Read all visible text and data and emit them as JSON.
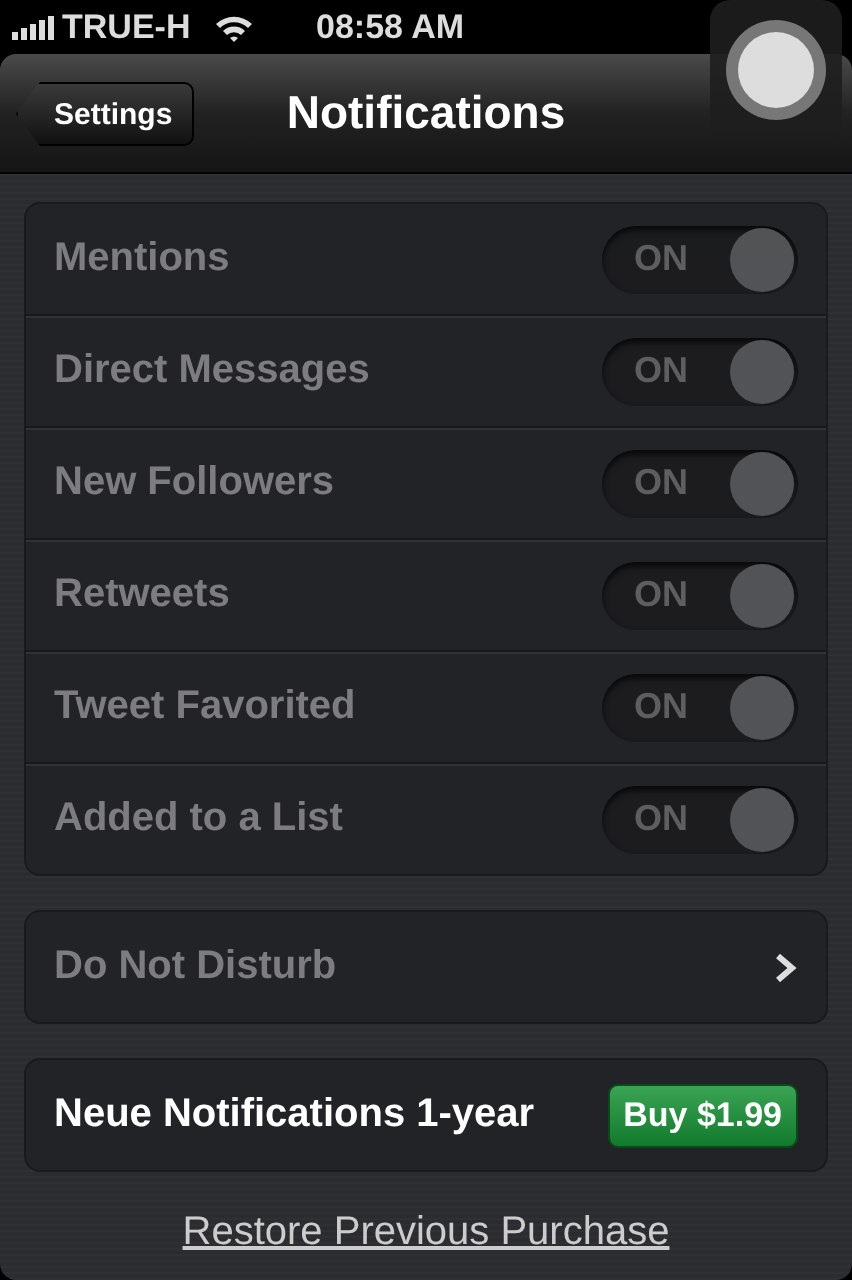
{
  "status_bar": {
    "carrier": "TRUE-H",
    "time": "08:58 AM"
  },
  "nav_bar": {
    "back_button": "Settings",
    "title": "Notifications"
  },
  "settings": [
    {
      "label": "Mentions",
      "on": true,
      "disabled": true,
      "switch_text": "ON"
    },
    {
      "label": "Direct Messages",
      "on": true,
      "disabled": true,
      "switch_text": "ON"
    },
    {
      "label": "New Followers",
      "on": true,
      "disabled": true,
      "switch_text": "ON"
    },
    {
      "label": "Retweets",
      "on": true,
      "disabled": true,
      "switch_text": "ON"
    },
    {
      "label": "Tweet Favorited",
      "on": true,
      "disabled": true,
      "switch_text": "ON"
    },
    {
      "label": "Added to a List",
      "on": true,
      "disabled": true,
      "switch_text": "ON"
    }
  ],
  "do_not_disturb": {
    "label": "Do Not Disturb",
    "disabled": true
  },
  "purchase": {
    "label": "Neue Notifications 1-year",
    "button": "Buy $1.99"
  },
  "restore_link": "Restore Previous Purchase"
}
